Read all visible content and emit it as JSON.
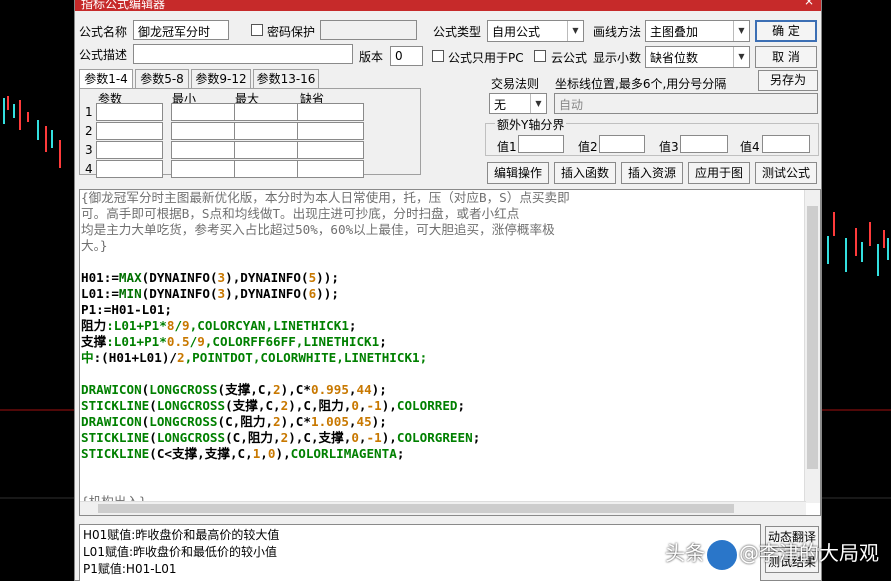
{
  "window": {
    "title": "指标公式编辑器",
    "close_glyph": "×"
  },
  "form": {
    "name_label": "公式名称",
    "name_value": "御龙冠军分时",
    "password_label": "密码保护",
    "type_label": "公式类型",
    "type_value": "自用公式",
    "draw_label": "画线方法",
    "draw_value": "主图叠加",
    "desc_label": "公式描述",
    "version_label": "版本",
    "version_value": "0",
    "pc_only_label": "公式只用于PC",
    "cloud_label": "云公式",
    "decimals_label": "显示小数",
    "decimals_value": "缺省位数"
  },
  "buttons": {
    "ok": "确 定",
    "cancel": "取 消",
    "save_as": "另存为",
    "edit_ops": "编辑操作",
    "insert_func": "插入函数",
    "insert_res": "插入资源",
    "apply": "应用于图",
    "test": "测试公式",
    "translate": "动态翻译",
    "test_result": "测试结果"
  },
  "tabs": [
    "参数1-4",
    "参数5-8",
    "参数9-12",
    "参数13-16"
  ],
  "params": {
    "headers": [
      "参数",
      "最小",
      "最大",
      "缺省"
    ],
    "rows": [
      "1",
      "2",
      "3",
      "4"
    ]
  },
  "trade_rule": {
    "label": "交易法则",
    "value": "无"
  },
  "coord": {
    "label": "坐标线位置,最多6个,用分号分隔",
    "value": "自动"
  },
  "yaxis": {
    "group_label": "额外Y轴分界",
    "labels": [
      "值1",
      "值2",
      "值3",
      "值4"
    ]
  },
  "code_lines": [
    [
      [
        "{御龙冠军分时主图最新优化版，本分时为本人日常使用，托，压（对应B，S）点买卖即",
        "cm"
      ]
    ],
    [
      [
        "可。高手即可根据B，S点和均线做T。出现庄进可抄底，分时扫盘，或者小红点",
        "cm"
      ]
    ],
    [
      [
        "均是主力大单吃货，参考买入占比超过50%，60%以上最佳，可大胆追买，涨停概率极",
        "cm"
      ]
    ],
    [
      [
        "大。}",
        "cm"
      ]
    ],
    [
      [
        "",
        ""
      ]
    ],
    [
      [
        "H01",
        "bk"
      ],
      [
        ":=",
        "bk"
      ],
      [
        "MAX",
        "fn"
      ],
      [
        "(",
        "bk"
      ],
      [
        "DYNAINFO",
        "bk"
      ],
      [
        "(",
        "bk"
      ],
      [
        "3",
        "num"
      ],
      [
        "),",
        "bk"
      ],
      [
        "DYNAINFO",
        "bk"
      ],
      [
        "(",
        "bk"
      ],
      [
        "5",
        "num"
      ],
      [
        "));",
        "bk"
      ]
    ],
    [
      [
        "L01",
        "bk"
      ],
      [
        ":=",
        "bk"
      ],
      [
        "MIN",
        "fn"
      ],
      [
        "(",
        "bk"
      ],
      [
        "DYNAINFO",
        "bk"
      ],
      [
        "(",
        "bk"
      ],
      [
        "3",
        "num"
      ],
      [
        "),",
        "bk"
      ],
      [
        "DYNAINFO",
        "bk"
      ],
      [
        "(",
        "bk"
      ],
      [
        "6",
        "num"
      ],
      [
        "));",
        "bk"
      ]
    ],
    [
      [
        "P1:=H01-L01;",
        "bk"
      ]
    ],
    [
      [
        "阻力",
        "bk"
      ],
      [
        ":L01+P1*",
        "gr"
      ],
      [
        "8",
        "num"
      ],
      [
        "/",
        "gr"
      ],
      [
        "9",
        "num"
      ],
      [
        ",",
        "gr"
      ],
      [
        "COLORCYAN",
        "gr"
      ],
      [
        ",",
        "gr"
      ],
      [
        "LINETHICK1",
        "gr"
      ],
      [
        ";",
        "bk"
      ]
    ],
    [
      [
        "支撑",
        "bk"
      ],
      [
        ":L01+P1*",
        "gr"
      ],
      [
        "0.5",
        "num"
      ],
      [
        "/",
        "gr"
      ],
      [
        "9",
        "num"
      ],
      [
        ",COLORFF66FF,LINETHICK1",
        "gr"
      ],
      [
        ";",
        "bk"
      ]
    ],
    [
      [
        "中",
        "gr"
      ],
      [
        ":(H01+L01)/",
        "bk"
      ],
      [
        "2",
        "num"
      ],
      [
        ",POINTDOT,COLORWHITE,LINETHICK1;",
        "gr"
      ]
    ],
    [
      [
        "",
        ""
      ]
    ],
    [
      [
        "DRAWICON",
        "gr"
      ],
      [
        "(",
        "bk"
      ],
      [
        "LONGCROSS",
        "gr"
      ],
      [
        "(支撑,C,",
        "bk"
      ],
      [
        "2",
        "num"
      ],
      [
        "),C*",
        "bk"
      ],
      [
        "0.995",
        "num"
      ],
      [
        ",",
        "bk"
      ],
      [
        "44",
        "num"
      ],
      [
        ");",
        "bk"
      ]
    ],
    [
      [
        "STICKLINE",
        "gr"
      ],
      [
        "(",
        "bk"
      ],
      [
        "LONGCROSS",
        "gr"
      ],
      [
        "(支撑,C,",
        "bk"
      ],
      [
        "2",
        "num"
      ],
      [
        "),C,阻力,",
        "bk"
      ],
      [
        "0",
        "num"
      ],
      [
        ",",
        "bk"
      ],
      [
        "-1",
        "num"
      ],
      [
        "),",
        "bk"
      ],
      [
        "COLORRED",
        "gr"
      ],
      [
        ";",
        "bk"
      ]
    ],
    [
      [
        "DRAWICON",
        "gr"
      ],
      [
        "(",
        "bk"
      ],
      [
        "LONGCROSS",
        "gr"
      ],
      [
        "(C,阻力,",
        "bk"
      ],
      [
        "2",
        "num"
      ],
      [
        "),C*",
        "bk"
      ],
      [
        "1.005",
        "num"
      ],
      [
        ",",
        "bk"
      ],
      [
        "45",
        "num"
      ],
      [
        ");",
        "bk"
      ]
    ],
    [
      [
        "STICKLINE",
        "gr"
      ],
      [
        "(",
        "bk"
      ],
      [
        "LONGCROSS",
        "gr"
      ],
      [
        "(C,阻力,",
        "bk"
      ],
      [
        "2",
        "num"
      ],
      [
        "),C,支撑,",
        "bk"
      ],
      [
        "0",
        "num"
      ],
      [
        ",",
        "bk"
      ],
      [
        "-1",
        "num"
      ],
      [
        "),",
        "bk"
      ],
      [
        "COLORGREEN",
        "gr"
      ],
      [
        ";",
        "bk"
      ]
    ],
    [
      [
        "STICKLINE",
        "gr"
      ],
      [
        "(C<支撑,支撑,C,",
        "bk"
      ],
      [
        "1",
        "num"
      ],
      [
        ",",
        "bk"
      ],
      [
        "0",
        "num"
      ],
      [
        "),",
        "bk"
      ],
      [
        "COLORLIMAGENTA",
        "gr"
      ],
      [
        ";",
        "bk"
      ]
    ],
    [
      [
        "",
        ""
      ]
    ],
    [
      [
        "",
        ""
      ]
    ],
    [
      [
        "{机构出入}",
        "cm"
      ]
    ]
  ],
  "description_lines": [
    "H01赋值:昨收盘价和最高价的较大值",
    "L01赋值:昨收盘价和最低价的较小值",
    "P1赋值:H01-L01"
  ],
  "watermark": {
    "prefix": "头条",
    "handle": "@李津的大局观"
  },
  "colors": {
    "comment": "#707070",
    "green": "#008000",
    "number": "#c87800",
    "black": "#000000",
    "fn": "#007000"
  }
}
